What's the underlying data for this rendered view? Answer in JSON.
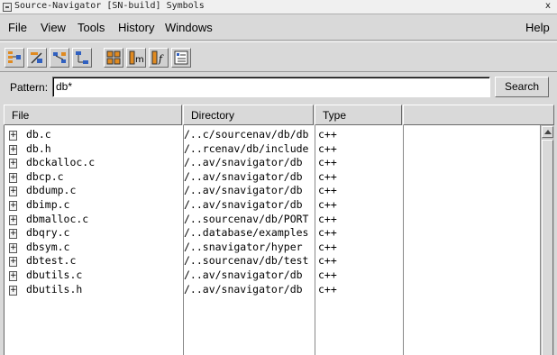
{
  "window": {
    "title": "Source-Navigator [SN-build] Symbols",
    "close": "x"
  },
  "menu": [
    "File",
    "View",
    "Tools",
    "History",
    "Windows",
    "Help"
  ],
  "toolbar": {
    "buttons": [
      {
        "icon": "hierarchy-icon"
      },
      {
        "icon": "retriever-icon"
      },
      {
        "icon": "xref-icon"
      },
      {
        "icon": "include-icon"
      },
      {
        "icon": "classes-icon"
      },
      {
        "icon": "methods-icon"
      },
      {
        "icon": "functions-icon"
      },
      {
        "icon": "list-icon"
      }
    ]
  },
  "pattern": {
    "label": "Pattern:",
    "value": "db*",
    "button": "Search"
  },
  "columns": [
    "File",
    "Directory",
    "Type"
  ],
  "rows": [
    {
      "file": "db.c",
      "dir": "/..c/sourcenav/db/db",
      "type": "c++"
    },
    {
      "file": "db.h",
      "dir": "/..rcenav/db/include",
      "type": "c++"
    },
    {
      "file": "dbckalloc.c",
      "dir": "/..av/snavigator/db",
      "type": "c++"
    },
    {
      "file": "dbcp.c",
      "dir": "/..av/snavigator/db",
      "type": "c++"
    },
    {
      "file": "dbdump.c",
      "dir": "/..av/snavigator/db",
      "type": "c++"
    },
    {
      "file": "dbimp.c",
      "dir": "/..av/snavigator/db",
      "type": "c++"
    },
    {
      "file": "dbmalloc.c",
      "dir": "/..sourcenav/db/PORT",
      "type": "c++"
    },
    {
      "file": "dbqry.c",
      "dir": "/..database/examples",
      "type": "c++"
    },
    {
      "file": "dbsym.c",
      "dir": "/..snavigator/hyper",
      "type": "c++"
    },
    {
      "file": "dbtest.c",
      "dir": "/..sourcenav/db/test",
      "type": "c++"
    },
    {
      "file": "dbutils.c",
      "dir": "/..av/snavigator/db",
      "type": "c++"
    },
    {
      "file": "dbutils.h",
      "dir": "/..av/snavigator/db",
      "type": "c++"
    }
  ]
}
